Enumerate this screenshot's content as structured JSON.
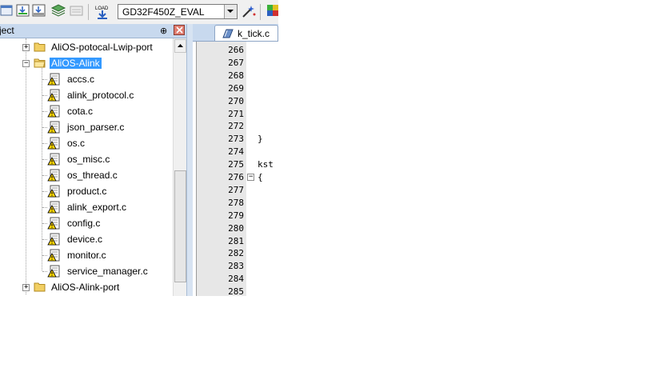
{
  "toolbar": {
    "icons": [
      "window-icon",
      "download-icon",
      "batch-build-icon",
      "options-icon",
      "manage-icon",
      "load-icon",
      "magic-wand-icon",
      "pack-installer-icon"
    ],
    "load_label": "LOAD",
    "target_value": "GD32F450Z_EVAL"
  },
  "project_pane": {
    "title": "ject",
    "pin_glyph": "⊕",
    "close_glyph": "✕"
  },
  "tree": {
    "groups": [
      {
        "label": "AliOS-potocal-Lwip-port",
        "expanded": false
      },
      {
        "label": "AliOS-Alink",
        "expanded": true,
        "selected": true
      },
      {
        "label": "AliOS-Alink-port",
        "expanded": false
      }
    ],
    "files": [
      "accs.c",
      "alink_protocol.c",
      "cota.c",
      "json_parser.c",
      "os.c",
      "os_misc.c",
      "os_thread.c",
      "product.c",
      "alink_export.c",
      "config.c",
      "device.c",
      "monitor.c",
      "service_manager.c"
    ]
  },
  "editor": {
    "tab_label": "k_tick.c",
    "line_numbers": [
      "266",
      "267",
      "268",
      "269",
      "270",
      "271",
      "272",
      "273",
      "274",
      "275",
      "276",
      "277",
      "278",
      "279",
      "280",
      "281",
      "282",
      "283",
      "284",
      "285"
    ],
    "code_lines": {
      "273": "}",
      "275": "kst",
      "276": "{"
    },
    "fold_line": "276"
  },
  "colors": {
    "selection": "#3399ff",
    "pane_header": "#c8d9ee",
    "gutter": "#e7e7e7"
  }
}
